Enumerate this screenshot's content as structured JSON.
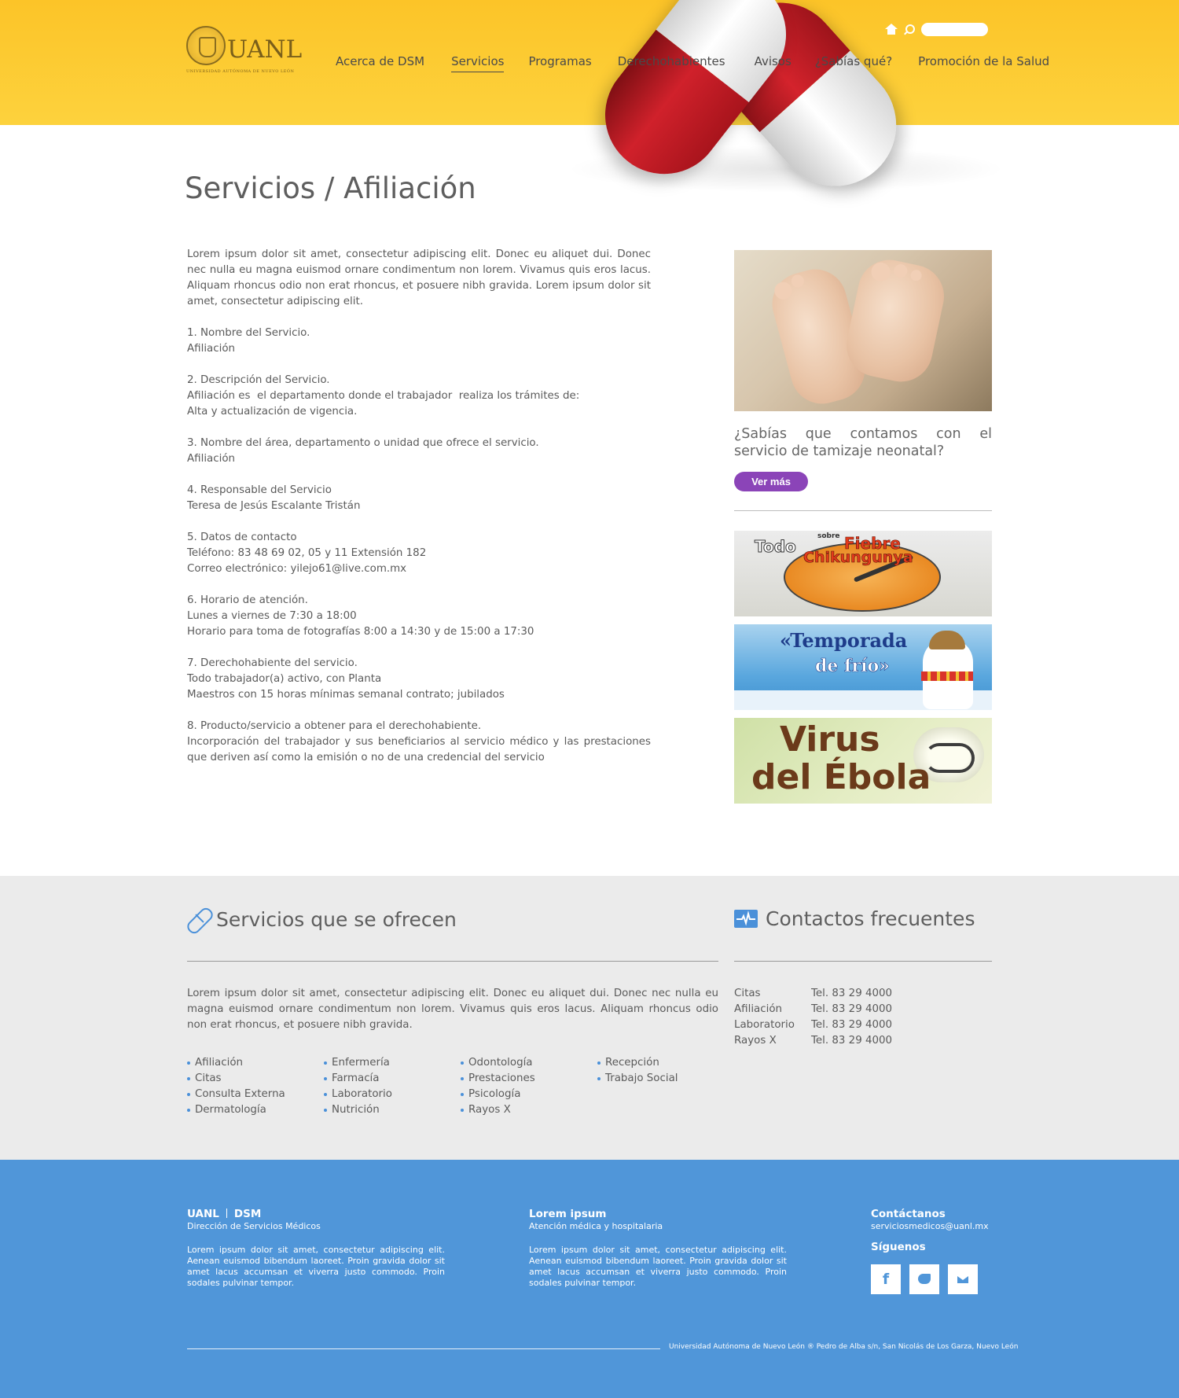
{
  "header": {
    "logo_text": "UANL",
    "logo_subtitle": "UNIVERSIDAD AUTÓNOMA DE NUEVO LEÓN",
    "nav": [
      {
        "label": "Acerca de DSM"
      },
      {
        "label": "Servicios",
        "active": true
      },
      {
        "label": "Programas"
      },
      {
        "label": "Derechohabientes"
      },
      {
        "label": "Avisos"
      },
      {
        "label": "¿Sabías qué?"
      },
      {
        "label": "Promoción de la Salud"
      }
    ],
    "search_placeholder": ""
  },
  "page_title": "Servicios / Afiliación",
  "main": {
    "intro": "Lorem ipsum dolor sit amet, consectetur adipiscing elit. Donec eu aliquet dui. Donec nec nulla eu magna euismod ornare condimentum non lorem. Vivamus quis eros lacus. Aliquam rhoncus odio non erat rhoncus, et posuere nibh gravida. Lorem ipsum dolor sit amet, consectetur adipiscing elit.",
    "sections": [
      {
        "title": "1. Nombre del Servicio.",
        "lines": [
          "Afiliación"
        ]
      },
      {
        "title": "2. Descripción del Servicio.",
        "lines": [
          "Afiliación es  el departamento donde el trabajador  realiza los trámites de:",
          "Alta y actualización de vigencia."
        ]
      },
      {
        "title": "3. Nombre del área, departamento o unidad que ofrece el servicio.",
        "lines": [
          "Afiliación"
        ]
      },
      {
        "title": "4. Responsable del Servicio",
        "lines": [
          "Teresa de Jesús Escalante Tristán"
        ]
      },
      {
        "title": "5. Datos de contacto",
        "lines": [
          "Teléfono: 83 48 69 02, 05 y 11 Extensión 182",
          "Correo electrónico: yilejo61@live.com.mx"
        ]
      },
      {
        "title": "6. Horario de atención.",
        "lines": [
          "Lunes a viernes de 7:30 a 18:00",
          "Horario para toma de fotografías 8:00 a 14:30 y de 15:00 a 17:30"
        ]
      },
      {
        "title": "7. Derechohabiente del servicio.",
        "lines": [
          "Todo trabajador(a) activo, con Planta",
          "Maestros con 15 horas mínimas semanal contrato; jubilados"
        ]
      },
      {
        "title": "8. Producto/servicio a obtener para el derechohabiente.",
        "lines": [
          " Incorporación del trabajador y sus beneficiarios al servicio médico y las prestaciones que deriven así como la emisión o no de una credencial del servicio"
        ]
      }
    ]
  },
  "sidebar": {
    "sabias_text": "¿Sabías que contamos con el servicio de tamizaje neonatal?",
    "ver_mas": "Ver más",
    "banner1": {
      "word1": "Todo",
      "word2": "sobre",
      "word3": "Fiebre",
      "word4": "Chikungunya"
    },
    "banner2": {
      "line1": "«Temporada",
      "line2": "de frío»"
    },
    "banner3": {
      "line1": "Virus",
      "line2": "del Ébola"
    }
  },
  "services": {
    "title": "Servicios que se ofrecen",
    "description": "Lorem ipsum dolor sit amet, consectetur adipiscing elit. Donec eu aliquet dui. Donec nec nulla eu magna euismod ornare condimentum non lorem. Vivamus quis eros lacus. Aliquam rhoncus odio non erat rhoncus, et posuere nibh gravida.",
    "columns": [
      [
        "Afiliación",
        "Citas",
        "Consulta Externa",
        "Dermatología"
      ],
      [
        "Enfermería",
        "Farmacía",
        "Laboratorio",
        "Nutrición"
      ],
      [
        "Odontología",
        "Prestaciones",
        "Psicología",
        "Rayos X"
      ],
      [
        "Recepción",
        "Trabajo Social"
      ]
    ]
  },
  "contacts": {
    "title": "Contactos frecuentes",
    "rows": [
      {
        "name": "Citas",
        "tel": "Tel. 83 29 4000"
      },
      {
        "name": "Afiliación",
        "tel": "Tel. 83 29 4000"
      },
      {
        "name": "Laboratorio",
        "tel": "Tel. 83 29 4000"
      },
      {
        "name": "Rayos X",
        "tel": "Tel. 83 29 4000"
      }
    ]
  },
  "footer": {
    "col1": {
      "h1": "UANL",
      "h2": "DSM",
      "sub": "Dirección de Servicios Médicos",
      "text": "Lorem ipsum dolor sit amet, consectetur adipiscing elit. Aenean euismod bibendum laoreet. Proin gravida dolor sit amet lacus accumsan et viverra justo commodo. Proin sodales pulvinar tempor."
    },
    "col2": {
      "h": "Lorem ipsum",
      "sub": "Atención médica y hospitalaria",
      "text": "Lorem ipsum dolor sit amet, consectetur adipiscing elit. Aenean euismod bibendum laoreet. Proin gravida dolor sit amet lacus accumsan et viverra justo commodo. Proin sodales pulvinar tempor."
    },
    "contact_title": "Contáctanos",
    "contact_email": "serviciosmedicos@uanl.mx",
    "follow_title": "Síguenos",
    "social_icons": [
      "facebook-icon",
      "twitter-icon",
      "mail-icon"
    ],
    "address": "Universidad Autónoma de Nuevo León ® Pedro de Alba s/n, San Nicolás de Los Garza, Nuevo León"
  },
  "colors": {
    "header": "#fcc428",
    "accent_blue": "#5096d9",
    "button_purple": "#8b44b8",
    "gray_band": "#ebebeb"
  }
}
